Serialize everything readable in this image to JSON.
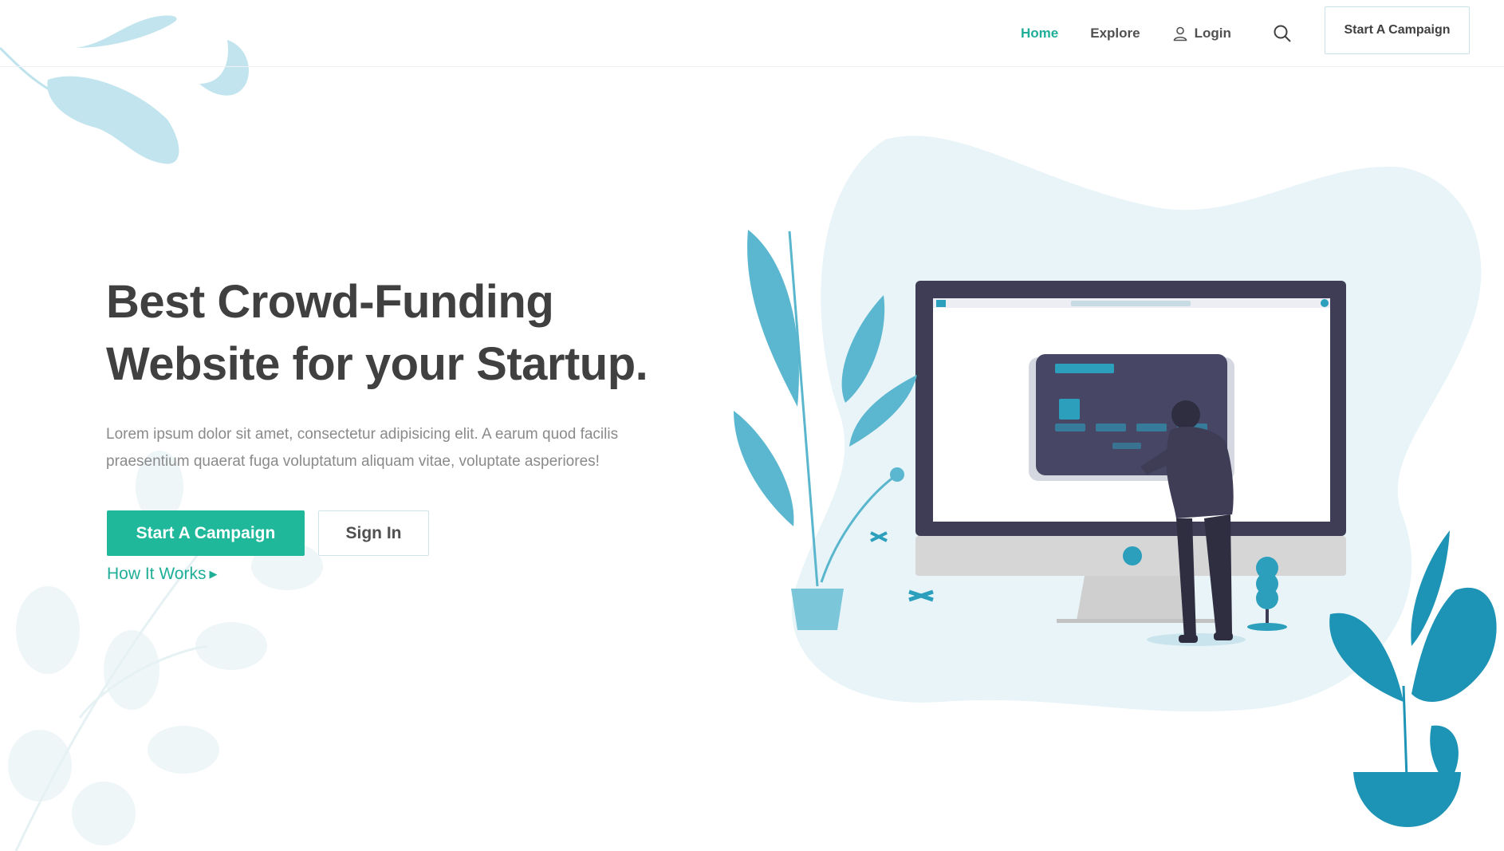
{
  "nav": {
    "items": [
      {
        "label": "Home",
        "active": true
      },
      {
        "label": "Explore",
        "active": false
      },
      {
        "label": "Login",
        "active": false
      }
    ],
    "search_icon": "search-icon",
    "login_icon": "user-icon",
    "cta_label": "Start A Campaign"
  },
  "hero": {
    "title_line1": "Best Crowd-Funding",
    "title_line2": "Website for your Startup.",
    "description_line1": "Lorem ipsum dolor sit amet, consectetur adipisicing elit. A earum quod facilis",
    "description_line2": "praesentium quaerat fuga voluptatum aliquam vitae, voluptate asperiores!",
    "primary_button": "Start A Campaign",
    "secondary_button": "Sign In",
    "how_link": "How It Works",
    "how_icon": "caret-right-icon"
  },
  "colors": {
    "accent": "#1fb89a",
    "accent_text": "#1fae98",
    "heading": "#404040",
    "body_text": "#8a8a8a",
    "illustration_blue": "#2c9fbd",
    "blob": "#e8f4f8"
  }
}
